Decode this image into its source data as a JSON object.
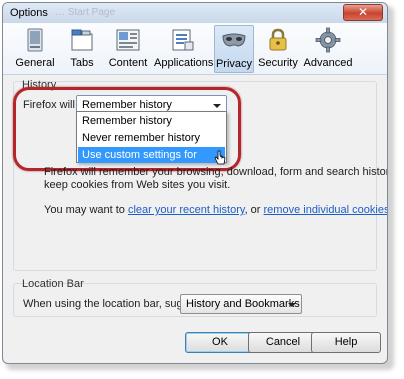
{
  "window": {
    "title": "Options",
    "title_ghost": "… Start Page",
    "close_glyph": "✕"
  },
  "tabs": [
    {
      "label": "General",
      "icon": "general-icon"
    },
    {
      "label": "Tabs",
      "icon": "tabs-icon"
    },
    {
      "label": "Content",
      "icon": "content-icon"
    },
    {
      "label": "Applications",
      "icon": "applications-icon"
    },
    {
      "label": "Privacy",
      "icon": "privacy-mask-icon",
      "active": true
    },
    {
      "label": "Security",
      "icon": "lock-icon"
    },
    {
      "label": "Advanced",
      "icon": "gear-icon"
    }
  ],
  "history": {
    "group_label": "History",
    "firefox_will_label": "Firefox will:",
    "combo_value": "Remember history",
    "options": [
      "Remember history",
      "Never remember history",
      "Use custom settings for history"
    ],
    "selected_option_index": 2,
    "description_line1": "Firefox will remember your browsing, download, form and search history, and",
    "description_line2": "keep cookies from Web sites you visit.",
    "may_want_prefix": "You may want to ",
    "clear_link": "clear your recent history",
    "may_want_middle": ", or ",
    "remove_link": "remove individual cookies",
    "may_want_suffix": "."
  },
  "location_bar": {
    "group_label": "Location Bar",
    "suggest_label": "When using the location bar, suggest:",
    "suggest_value": "History and Bookmarks"
  },
  "buttons": {
    "ok": "OK",
    "cancel": "Cancel",
    "help": "Help"
  },
  "colors": {
    "highlight_ring": "#b3262c",
    "selection": "#3399ff",
    "link": "#1d5ec7"
  }
}
